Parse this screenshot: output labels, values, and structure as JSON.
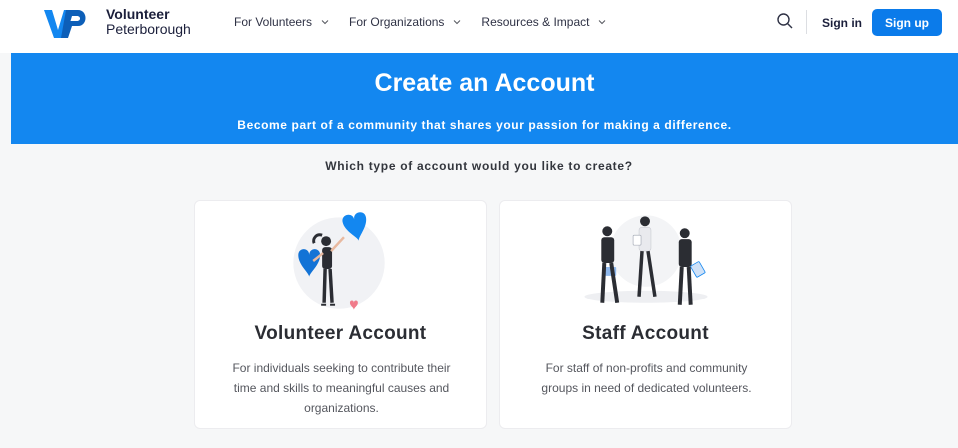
{
  "header": {
    "logo": {
      "line1": "Volunteer",
      "line2": "Peterborough",
      "mark": "VP"
    },
    "nav": [
      {
        "label": "For Volunteers"
      },
      {
        "label": "For Organizations"
      },
      {
        "label": "Resources & Impact"
      }
    ],
    "search_icon": "search-icon",
    "signin_label": "Sign in",
    "signup_label": "Sign up"
  },
  "hero": {
    "title": "Create an Account",
    "subtitle": "Become part of a community that shares your passion for making a difference."
  },
  "question": "Which type of account would you like to create?",
  "cards": [
    {
      "title": "Volunteer Account",
      "description": "For individuals seeking to contribute their time and skills to meaningful causes and organizations.",
      "illustration": "volunteer-hearts-illustration"
    },
    {
      "title": "Staff Account",
      "description": "For staff of non-profits and community groups in need of dedicated volunteers.",
      "illustration": "staff-team-illustration"
    }
  ],
  "colors": {
    "brand_blue": "#1387f0",
    "button_blue": "#0b7bea",
    "dark_text": "#1b1f3b"
  }
}
